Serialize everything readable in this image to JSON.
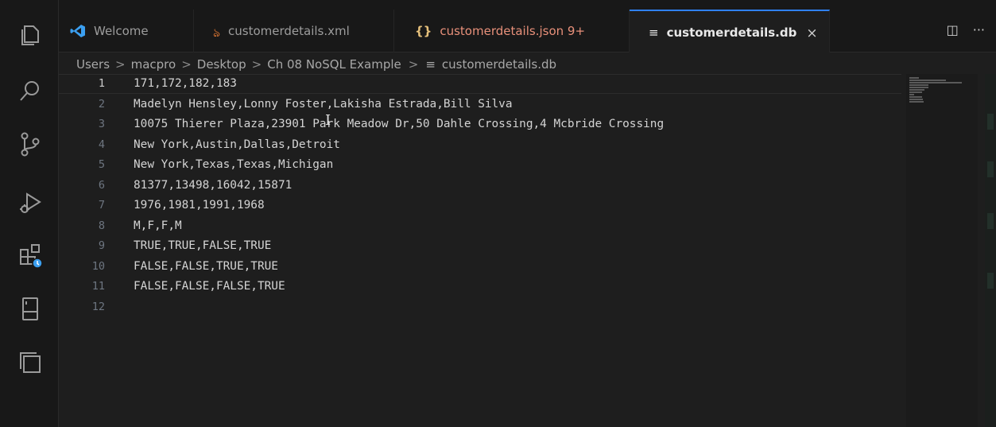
{
  "tabs": [
    {
      "label": "Welcome",
      "icon": "vscode-logo-icon",
      "icon_color": "#3b9ff0"
    },
    {
      "label": "customerdetails.xml",
      "icon": "rss-icon",
      "icon_color": "#e37933"
    },
    {
      "label": "customerdetails.json 9+",
      "icon": "braces-icon",
      "icon_color": "#e5c07b",
      "text_color": "#e8907a"
    },
    {
      "label": "customerdetails.db",
      "icon": "lines-icon",
      "close": "×"
    }
  ],
  "tab_actions": {
    "split": "◫",
    "more": "···"
  },
  "breadcrumb": {
    "items": [
      "Users",
      "macpro",
      "Desktop",
      "Ch 08 NoSQL Example"
    ],
    "file_icon": "≡",
    "file": "customerdetails.db",
    "separator": ">"
  },
  "editor": {
    "lines": [
      {
        "num": "1",
        "text": "171,172,182,183"
      },
      {
        "num": "2",
        "text": "Madelyn Hensley,Lonny Foster,Lakisha Estrada,Bill Silva"
      },
      {
        "num": "3",
        "text": "10075 Thierer Plaza,23901 Park Meadow Dr,50 Dahle Crossing,4 Mcbride Crossing"
      },
      {
        "num": "4",
        "text": "New York,Austin,Dallas,Detroit"
      },
      {
        "num": "5",
        "text": "New York,Texas,Texas,Michigan"
      },
      {
        "num": "6",
        "text": "81377,13498,16042,15871"
      },
      {
        "num": "7",
        "text": "1976,1981,1991,1968"
      },
      {
        "num": "8",
        "text": "M,F,F,M"
      },
      {
        "num": "9",
        "text": "TRUE,TRUE,FALSE,TRUE"
      },
      {
        "num": "10",
        "text": "FALSE,FALSE,TRUE,TRUE"
      },
      {
        "num": "11",
        "text": "FALSE,FALSE,FALSE,TRUE"
      },
      {
        "num": "12",
        "text": ""
      }
    ],
    "current_line": "1"
  },
  "activity_bar": {
    "items": [
      "explorer-icon",
      "search-icon",
      "source-control-icon",
      "run-debug-icon",
      "extensions-icon",
      "remote-explorer-icon",
      "panels-icon"
    ]
  },
  "colors": {
    "accent": "#2f81f7",
    "remote_badge": "#3b9ff0"
  }
}
